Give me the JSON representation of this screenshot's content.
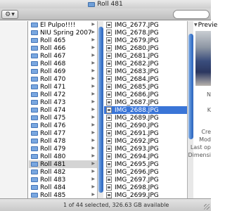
{
  "window": {
    "title": "Roll 481"
  },
  "toolbar": {
    "action_icon": "gear-icon",
    "action_glyph": "⚙",
    "caret_glyph": "▼"
  },
  "folders": [
    "El Pulpo!!!!",
    "NIU Spring 2007",
    "Roll 465",
    "Roll 466",
    "Roll 467",
    "Roll 468",
    "Roll 469",
    "Roll 470",
    "Roll 471",
    "Roll 472",
    "Roll 473",
    "Roll 474",
    "Roll 475",
    "Roll 476",
    "Roll 477",
    "Roll 478",
    "Roll 479",
    "Roll 480",
    "Roll 481",
    "Roll 482",
    "Roll 483",
    "Roll 484",
    "Roll 485"
  ],
  "selected_folder": "Roll 481",
  "files": [
    "IMG_2677.JPG",
    "IMG_2678.JPG",
    "IMG_2679.JPG",
    "IMG_2680.JPG",
    "IMG_2681.JPG",
    "IMG_2682.JPG",
    "IMG_2683.JPG",
    "IMG_2684.JPG",
    "IMG_2685.JPG",
    "IMG_2686.JPG",
    "IMG_2687.JPG",
    "IMG_2688.JPG",
    "IMG_2689.JPG",
    "IMG_2690.JPG",
    "IMG_2691.JPG",
    "IMG_2692.JPG",
    "IMG_2693.JPG",
    "IMG_2694.JPG",
    "IMG_2695.JPG",
    "IMG_2696.JPG",
    "IMG_2697.JPG",
    "IMG_2698.JPG",
    "IMG_2699.JPG"
  ],
  "selected_file": "IMG_2688.JPG",
  "preview": {
    "header": "Previe",
    "meta": [
      "N",
      "K",
      "Cre",
      "Mod",
      "Last op",
      "Dimensi"
    ]
  },
  "status": {
    "text": "1 of 44 selected, 326.63 GB available"
  },
  "arrow_glyph": "▶",
  "colors": {
    "selection": "#3a75d7",
    "folder": "#79a7e0",
    "scroll_thumb": "#3f79cc"
  }
}
